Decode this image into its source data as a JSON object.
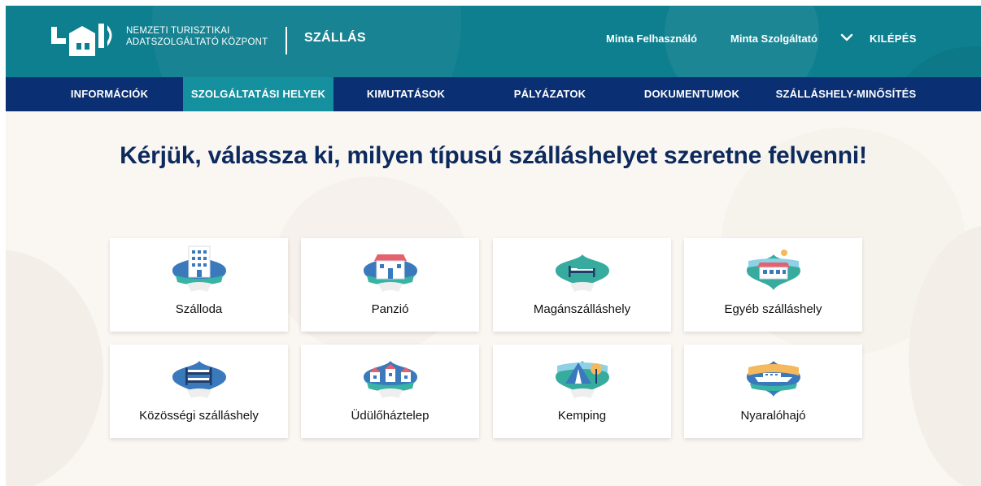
{
  "header": {
    "org_line1": "NEMZETI TURISZTIKAI",
    "org_line2": "ADATSZOLGÁLTATÓ KÖZPONT",
    "app_name": "SZÁLLÁS",
    "user_name": "Minta Felhasználó",
    "provider_name": "Minta Szolgáltató",
    "logout_label": "KILÉPÉS",
    "logo_icon": "ntak-logo",
    "dropdown_icon": "chevron-down-icon"
  },
  "nav": {
    "items": [
      {
        "label": "INFORMÁCIÓK",
        "active": false
      },
      {
        "label": "SZOLGÁLTATÁSI HELYEK",
        "active": true
      },
      {
        "label": "KIMUTATÁSOK",
        "active": false
      },
      {
        "label": "PÁLYÁZATOK",
        "active": false
      },
      {
        "label": "DOKUMENTUMOK",
        "active": false
      },
      {
        "label": "SZÁLLÁSHELY-MINŐSÍTÉS",
        "active": false
      }
    ]
  },
  "main": {
    "heading": "Kérjük, válassza ki, milyen típusú szálláshelyet szeretne felvenni!",
    "types": [
      {
        "label": "Szálloda",
        "icon": "hotel-icon"
      },
      {
        "label": "Panzió",
        "icon": "guesthouse-icon"
      },
      {
        "label": "Magánszálláshely",
        "icon": "private-accommodation-icon"
      },
      {
        "label": "Egyéb szálláshely",
        "icon": "other-accommodation-icon"
      },
      {
        "label": "Közösségi szálláshely",
        "icon": "hostel-bunk-bed-icon"
      },
      {
        "label": "Üdülőháztelep",
        "icon": "holiday-houses-icon"
      },
      {
        "label": "Kemping",
        "icon": "camping-tent-icon"
      },
      {
        "label": "Nyaralóhajó",
        "icon": "holiday-boat-icon"
      }
    ]
  },
  "colors": {
    "header_teal": "#0e7f8f",
    "nav_navy": "#0a2f73",
    "nav_active": "#14909f",
    "heading_navy": "#0d2a5e",
    "page_bg": "#faf7f3"
  }
}
